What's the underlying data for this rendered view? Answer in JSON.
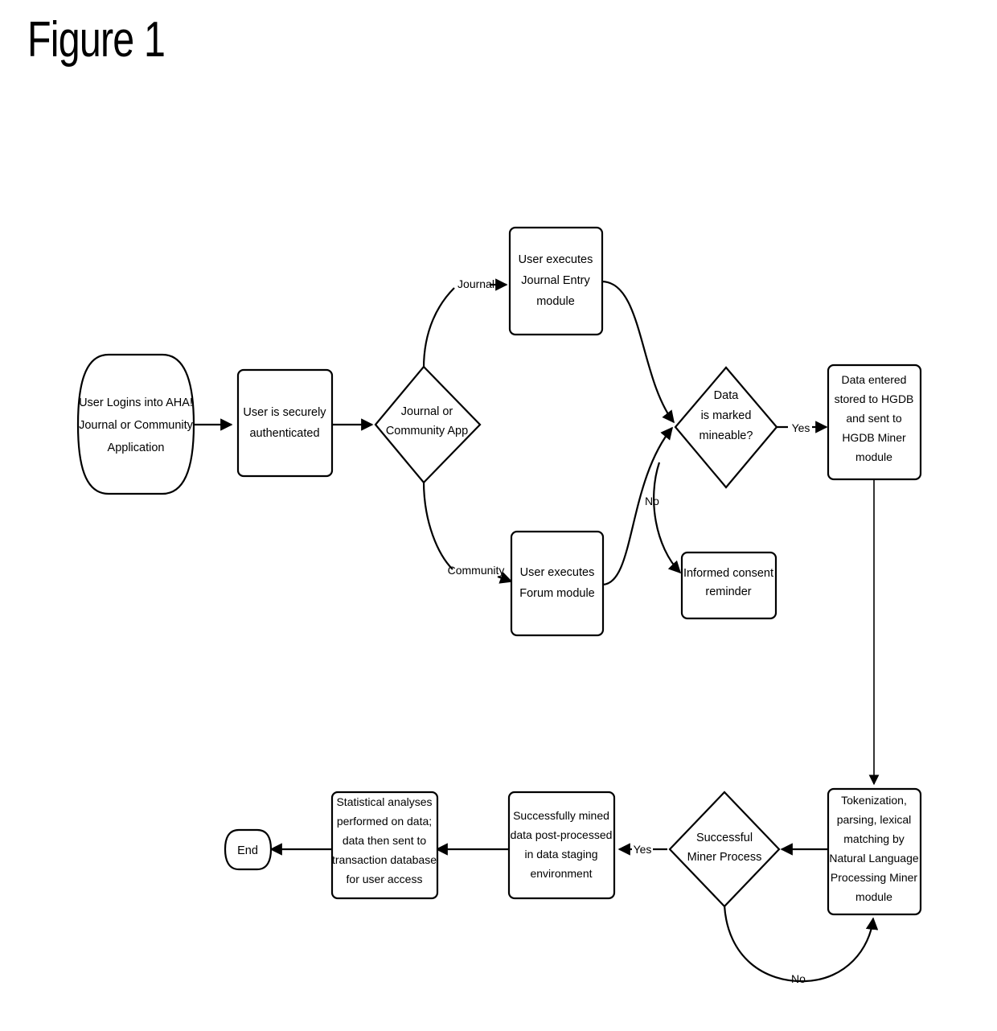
{
  "figure": {
    "title": "Figure 1"
  },
  "chart_data": {
    "type": "diagram",
    "title": "Figure 1",
    "diagram_kind": "flowchart",
    "nodes": [
      {
        "id": "start",
        "shape": "terminator-barrel",
        "lines": [
          "User Logins into AHA!",
          "Journal or Community",
          "Application"
        ]
      },
      {
        "id": "auth",
        "shape": "process",
        "lines": [
          "User is securely",
          "authenticated"
        ]
      },
      {
        "id": "appchoice",
        "shape": "decision",
        "lines": [
          "Journal or",
          "Community App"
        ]
      },
      {
        "id": "journal_entry",
        "shape": "process",
        "lines": [
          "User executes",
          "Journal Entry",
          "module"
        ]
      },
      {
        "id": "forum",
        "shape": "process",
        "lines": [
          "User executes",
          "Forum module"
        ]
      },
      {
        "id": "mineable",
        "shape": "decision",
        "lines": [
          "Data",
          "is marked",
          "mineable?"
        ]
      },
      {
        "id": "consent",
        "shape": "process",
        "lines": [
          "Informed consent",
          "reminder"
        ]
      },
      {
        "id": "hgdb",
        "shape": "process",
        "lines": [
          "Data entered",
          "stored to HGDB",
          "and sent to",
          "HGDB Miner",
          "module"
        ]
      },
      {
        "id": "nlp",
        "shape": "process",
        "lines": [
          "Tokenization,",
          "parsing, lexical",
          "matching by",
          "Natural Language",
          "Processing Miner",
          "module"
        ]
      },
      {
        "id": "minersuccess",
        "shape": "decision",
        "lines": [
          "Successful",
          "Miner Process"
        ]
      },
      {
        "id": "postprocess",
        "shape": "process",
        "lines": [
          "Successfully mined",
          "data post-processed",
          "in data staging",
          "environment"
        ]
      },
      {
        "id": "stats",
        "shape": "process",
        "lines": [
          "Statistical analyses",
          "performed on data;",
          "data then sent to",
          "transaction database",
          "for user access"
        ]
      },
      {
        "id": "end",
        "shape": "terminator-barrel",
        "lines": [
          "End"
        ]
      }
    ],
    "edges": [
      {
        "from": "start",
        "to": "auth",
        "label": ""
      },
      {
        "from": "auth",
        "to": "appchoice",
        "label": ""
      },
      {
        "from": "appchoice",
        "to": "journal_entry",
        "label": "Journal"
      },
      {
        "from": "appchoice",
        "to": "forum",
        "label": "Community"
      },
      {
        "from": "journal_entry",
        "to": "mineable",
        "label": ""
      },
      {
        "from": "forum",
        "to": "mineable",
        "label": ""
      },
      {
        "from": "mineable",
        "to": "hgdb",
        "label": "Yes"
      },
      {
        "from": "mineable",
        "to": "consent",
        "label": "No"
      },
      {
        "from": "hgdb",
        "to": "nlp",
        "label": ""
      },
      {
        "from": "nlp",
        "to": "minersuccess",
        "label": ""
      },
      {
        "from": "minersuccess",
        "to": "postprocess",
        "label": "Yes"
      },
      {
        "from": "minersuccess",
        "to": "nlp",
        "label": "No"
      },
      {
        "from": "postprocess",
        "to": "stats",
        "label": ""
      },
      {
        "from": "stats",
        "to": "end",
        "label": ""
      }
    ],
    "colors": {
      "stroke": "#000000",
      "fill": "#ffffff",
      "text": "#000000"
    }
  },
  "nodes": {
    "start": {
      "l0": "User Logins into AHA!",
      "l1": "Journal or Community",
      "l2": "Application"
    },
    "auth": {
      "l0": "User is securely",
      "l1": "authenticated"
    },
    "appchoice": {
      "l0": "Journal or",
      "l1": "Community App"
    },
    "journal_entry": {
      "l0": "User executes",
      "l1": "Journal Entry",
      "l2": "module"
    },
    "forum": {
      "l0": "User executes",
      "l1": "Forum module"
    },
    "mineable": {
      "l0": "Data",
      "l1": "is marked",
      "l2": "mineable?"
    },
    "consent": {
      "l0": "Informed consent",
      "l1": "reminder"
    },
    "hgdb": {
      "l0": "Data entered",
      "l1": "stored to HGDB",
      "l2": "and sent to",
      "l3": "HGDB Miner",
      "l4": "module"
    },
    "nlp": {
      "l0": "Tokenization,",
      "l1": "parsing, lexical",
      "l2": "matching by",
      "l3": "Natural Language",
      "l4": "Processing Miner",
      "l5": "module"
    },
    "minersuccess": {
      "l0": "Successful",
      "l1": "Miner Process"
    },
    "postprocess": {
      "l0": "Successfully mined",
      "l1": "data post-processed",
      "l2": "in data staging",
      "l3": "environment"
    },
    "stats": {
      "l0": "Statistical analyses",
      "l1": "performed on data;",
      "l2": "data then sent to",
      "l3": "transaction database",
      "l4": "for user access"
    },
    "end": {
      "l0": "End"
    }
  },
  "edge_labels": {
    "journal": "Journal",
    "community": "Community",
    "mineable_yes": "Yes",
    "mineable_no": "No",
    "miner_yes": "Yes",
    "miner_no": "No"
  }
}
